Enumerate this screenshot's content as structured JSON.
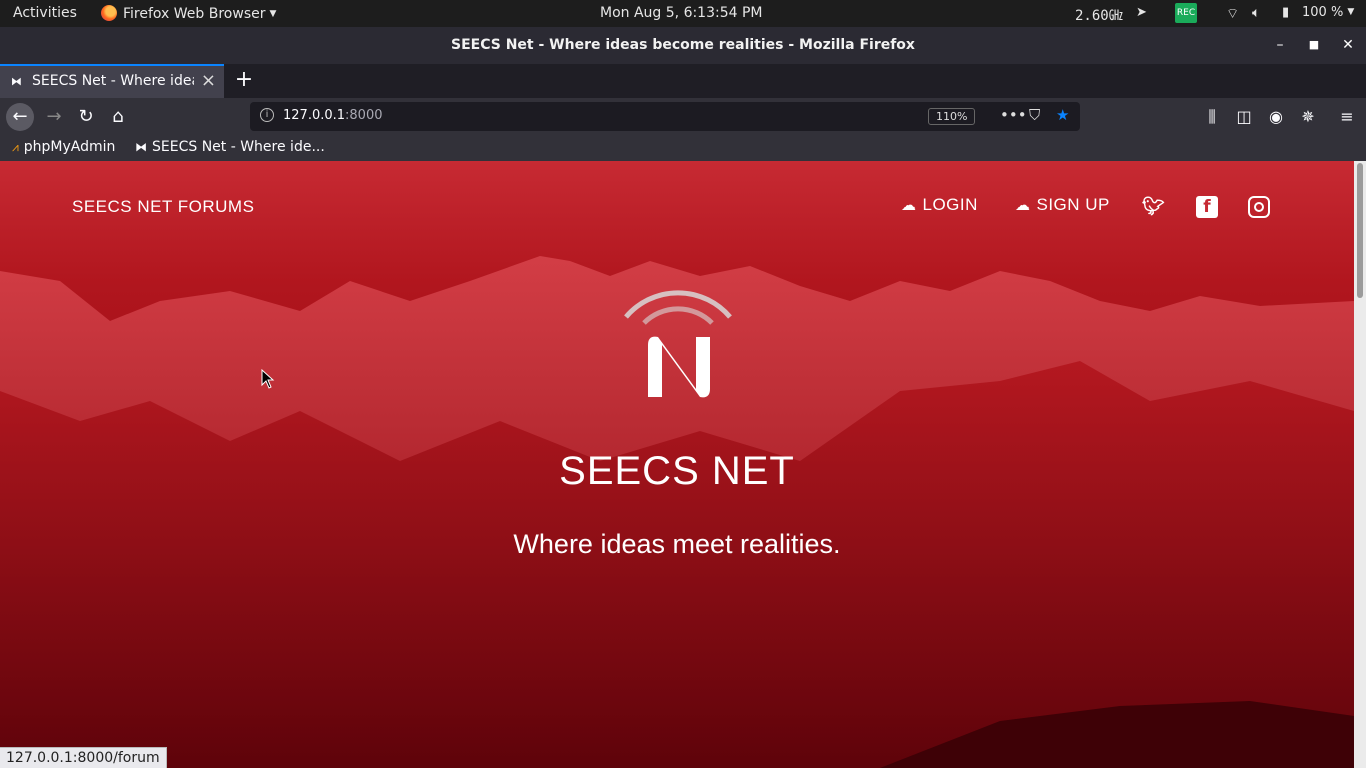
{
  "gnome": {
    "activities": "Activities",
    "app_name": "Firefox Web Browser",
    "clock": "Mon Aug  5,  6:13:54 PM",
    "cpu": "2.60㎓",
    "battery": "100 %"
  },
  "window": {
    "title": "SEECS Net - Where ideas become realities - Mozilla Firefox"
  },
  "tabs": [
    {
      "label": "SEECS Net - Where ideas"
    }
  ],
  "urlbar": {
    "host": "127.0.0.1",
    "port": ":8000",
    "zoom": "110%"
  },
  "bookmarks": [
    {
      "label": "phpMyAdmin",
      "icon": "phpmyadmin-icon"
    },
    {
      "label": "SEECS Net - Where ide...",
      "icon": "seecs-favicon"
    }
  ],
  "page": {
    "brand": "SEECS NET FORUMS",
    "nav": {
      "login": "LOGIN",
      "signup": "SIGN UP"
    },
    "social": [
      "twitter-icon",
      "facebook-icon",
      "instagram-icon"
    ],
    "hero_title": "SEECS NET",
    "hero_subtitle": "Where ideas meet realities."
  },
  "status_url": "127.0.0.1:8000/forum",
  "colors": {
    "accent": "#0a84ff",
    "hero_red": "#b1161e"
  }
}
